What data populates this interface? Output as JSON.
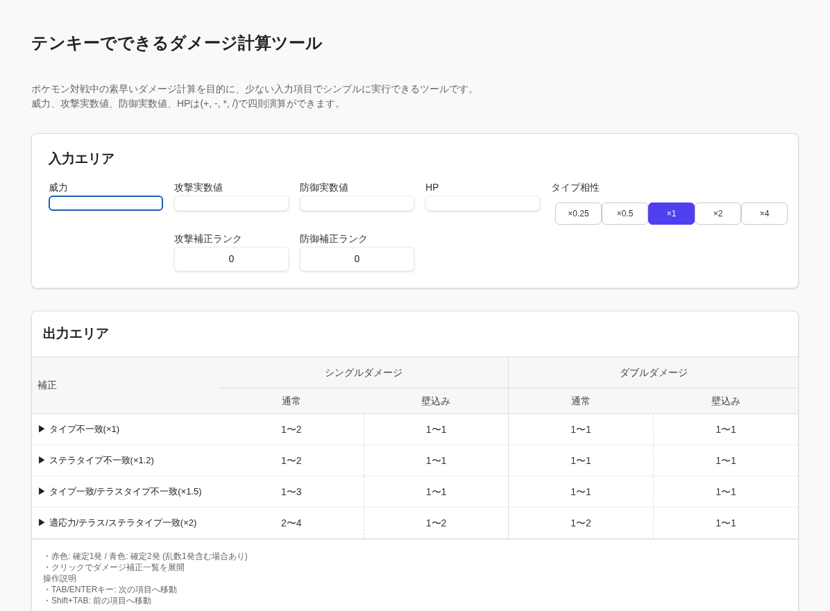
{
  "title": "テンキーでできるダメージ計算ツール",
  "description": [
    "ポケモン対戦中の素早いダメージ計算を目的に、少ない入力項目でシンプルに実行できるツールです。",
    "威力、攻撃実数値、防御実数値、HPは(+, -, *, /)で四則演算ができます。"
  ],
  "input_area": {
    "heading": "入力エリア",
    "fields": [
      {
        "label": "威力",
        "focused": true
      },
      {
        "label": "攻撃実数値",
        "focused": false
      },
      {
        "label": "防御実数値",
        "focused": false
      },
      {
        "label": "HP",
        "focused": false
      }
    ],
    "type_label": "タイプ相性",
    "type_options": [
      {
        "label": "×0.25",
        "selected": false
      },
      {
        "label": "×0.5",
        "selected": false
      },
      {
        "label": "×1",
        "selected": true
      },
      {
        "label": "×2",
        "selected": false
      },
      {
        "label": "×4",
        "selected": false
      }
    ],
    "ranks": [
      {
        "label": "攻撃補正ランク",
        "value": "0"
      },
      {
        "label": "防御補正ランク",
        "value": "0"
      }
    ]
  },
  "output_area": {
    "heading": "出力エリア",
    "table": {
      "corner": "補正",
      "groups": [
        "シングルダメージ",
        "ダブルダメージ"
      ],
      "subcolumns": [
        "通常",
        "壁込み",
        "通常",
        "壁込み"
      ],
      "rows": [
        {
          "label": "▶ タイプ不一致(×1)",
          "values": [
            "1〜2",
            "1〜1",
            "1〜1",
            "1〜1"
          ]
        },
        {
          "label": "▶ ステラタイプ不一致(×1.2)",
          "values": [
            "1〜2",
            "1〜1",
            "1〜1",
            "1〜1"
          ]
        },
        {
          "label": "▶ タイプ一致/テラスタイプ不一致(×1.5)",
          "values": [
            "1〜3",
            "1〜1",
            "1〜1",
            "1〜1"
          ]
        },
        {
          "label": "▶ 適応力/テラス/ステラタイプ一致(×2)",
          "values": [
            "2〜4",
            "1〜2",
            "1〜2",
            "1〜1"
          ]
        }
      ]
    },
    "notes": [
      "・赤色: 確定1発 / 青色: 確定2発 (乱数1発含む場合あり)",
      "・クリックでダメージ補正一覧を展開",
      "操作説明",
      "・TAB/ENTERキー: 次の項目へ移動",
      "・Shift+TAB: 前の項目へ移動"
    ]
  }
}
